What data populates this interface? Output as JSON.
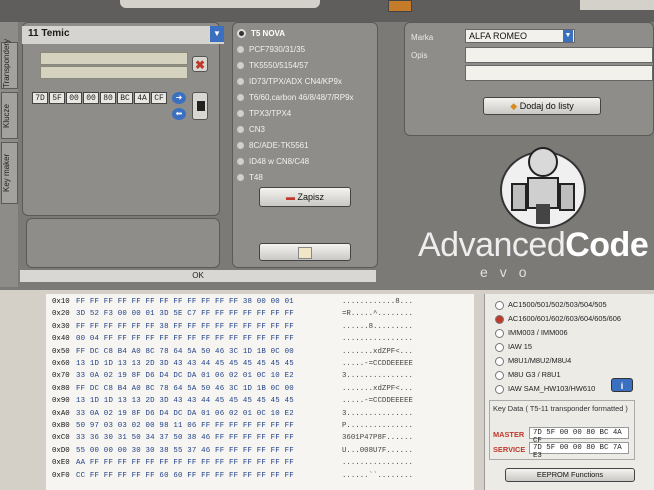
{
  "window": {
    "vertical_tabs": [
      "Key maker",
      "Klucze",
      "Transpondery"
    ],
    "transponder_select": "11 Temic",
    "hex_bytes": [
      "7D",
      "5F",
      "00",
      "00",
      "80",
      "BC",
      "4A",
      "CF"
    ],
    "ok_label": "OK"
  },
  "radio_group": {
    "items": [
      {
        "label": "T5 NOVA",
        "selected": true
      },
      {
        "label": "PCF7930/31/35",
        "selected": false
      },
      {
        "label": "TK5550/5154/57",
        "selected": false
      },
      {
        "label": "ID73/TPX/ADX CN4/KP9x",
        "selected": false
      },
      {
        "label": "T6/60,carbon 46/8/48/7/RP9x",
        "selected": false
      },
      {
        "label": "TPX3/TPX4",
        "selected": false
      },
      {
        "label": "CN3",
        "selected": false
      },
      {
        "label": "8C/ADE-TK5561",
        "selected": false
      },
      {
        "label": "ID48 w CN8/C48",
        "selected": false
      },
      {
        "label": "T48",
        "selected": false
      }
    ],
    "save_label": "Zapisz"
  },
  "car_panel": {
    "marka_label": "Marka",
    "marka_value": "ALFA ROMEO",
    "opis_label": "Opis",
    "add_button": "Dodaj do listy"
  },
  "logo": {
    "main": "Advanced",
    "bold": "Code",
    "sub": "evo"
  },
  "hex_dump": [
    {
      "addr": "0x10",
      "hex": "FF FF FF FF FF FF FF FF FF FF FF FF 38 00 00 01",
      "ascii": "............8..."
    },
    {
      "addr": "0x20",
      "hex": "3D 52 F3 00 00 01 3D 5E C7 FF FF FF FF FF FF FF",
      "ascii": "=R.....^........"
    },
    {
      "addr": "0x30",
      "hex": "FF FF FF FF FF FF 38 FF FF FF FF FF FF FF FF FF",
      "ascii": "......8........."
    },
    {
      "addr": "0x40",
      "hex": "00 04 FF FF FF FF FF FF FF FF FF FF FF FF FF FF",
      "ascii": "................"
    },
    {
      "addr": "0x50",
      "hex": "FF DC C8 B4 A0 8C 78 64 5A 50 46 3C 1D 1B 0C 00",
      "ascii": ".......xdZPF<..."
    },
    {
      "addr": "0x60",
      "hex": "13 1D 1D 13 13 2D 3D 43 43 44 45 45 45 45 45 45",
      "ascii": ".....-=CCDDEEEEE"
    },
    {
      "addr": "0x70",
      "hex": "33 0A 02 19 8F D6 D4 DC DA 01 06 02 01 0C 10 E2",
      "ascii": "3..............."
    },
    {
      "addr": "0x80",
      "hex": "FF DC C8 B4 A0 8C 78 64 5A 50 46 3C 1D 1B 0C 00",
      "ascii": ".......xdZPF<..."
    },
    {
      "addr": "0x90",
      "hex": "13 1D 1D 13 13 2D 3D 43 43 44 45 45 45 45 45 45",
      "ascii": ".....-=CCDDEEEEE"
    },
    {
      "addr": "0xA0",
      "hex": "33 0A 02 19 8F D6 D4 DC DA 01 06 02 01 0C 10 E2",
      "ascii": "3..............."
    },
    {
      "addr": "0xB0",
      "hex": "50 97 03 03 02 00 98 11 06 FF FF FF FF FF FF FF",
      "ascii": "P..............."
    },
    {
      "addr": "0xC0",
      "hex": "33 36 30 31 50 34 37 50 38 46 FF FF FF FF FF FF",
      "ascii": "3601P47P8F......"
    },
    {
      "addr": "0xD0",
      "hex": "55 00 00 00 30 30 38 55 37 46 FF FF FF FF FF FF",
      "ascii": "U...008U7F......"
    },
    {
      "addr": "0xE0",
      "hex": "AA FF FF FF FF FF FF FF FF FF FF FF FF FF FF FF",
      "ascii": "................"
    },
    {
      "addr": "0xF0",
      "hex": "CC FF FF FF FF FF 60 60 FF FF FF FF FF FF FF FF",
      "ascii": "......``........"
    }
  ],
  "ecu_list": {
    "items": [
      {
        "label": "AC1500/501/502/503/504/505",
        "selected": false
      },
      {
        "label": "AC1600/601/602/603/604/605/606",
        "selected": true
      },
      {
        "label": "IMM003 / IMM006",
        "selected": false
      },
      {
        "label": "IAW 15",
        "selected": false
      },
      {
        "label": "M8U1/M8U2/M8U4",
        "selected": false
      },
      {
        "label": "M8U G3 / R8U1",
        "selected": false
      },
      {
        "label": "IAW SAM_HW103/HW610",
        "selected": false
      }
    ],
    "key_data_title": "Key Data ( T5-11 transponder formatted )",
    "master_label": "MASTER",
    "master_value": "7D 5F 00 00 80 BC 4A CF",
    "service_label": "SERVICE",
    "service_value": "7D 5F 00 00 80 BC 7A E3",
    "eeprom_button": "EEPROM Functions"
  }
}
